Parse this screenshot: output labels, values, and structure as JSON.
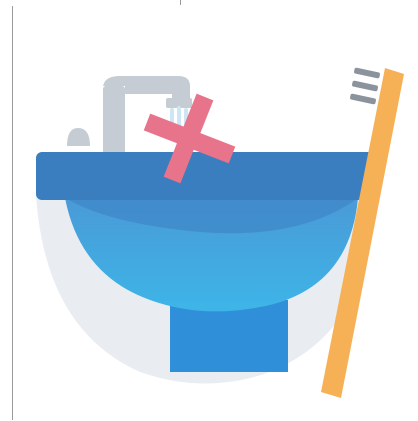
{
  "illustration": {
    "subject": "water-saving-illustration",
    "colors": {
      "background": "#ffffff",
      "sink_rim": "#3a7ebf",
      "sink_bowl_top": "#4a9ad6",
      "sink_bowl_bottom": "#3db5e8",
      "sink_outer": "#e9edf2",
      "pedestal": "#2f8fd8",
      "faucet": "#c6ccd4",
      "water": "#cde6f5",
      "cross": "#e8748b",
      "toothbrush_handle": "#f6b156",
      "toothbrush_bristles": "#8b939c"
    }
  }
}
